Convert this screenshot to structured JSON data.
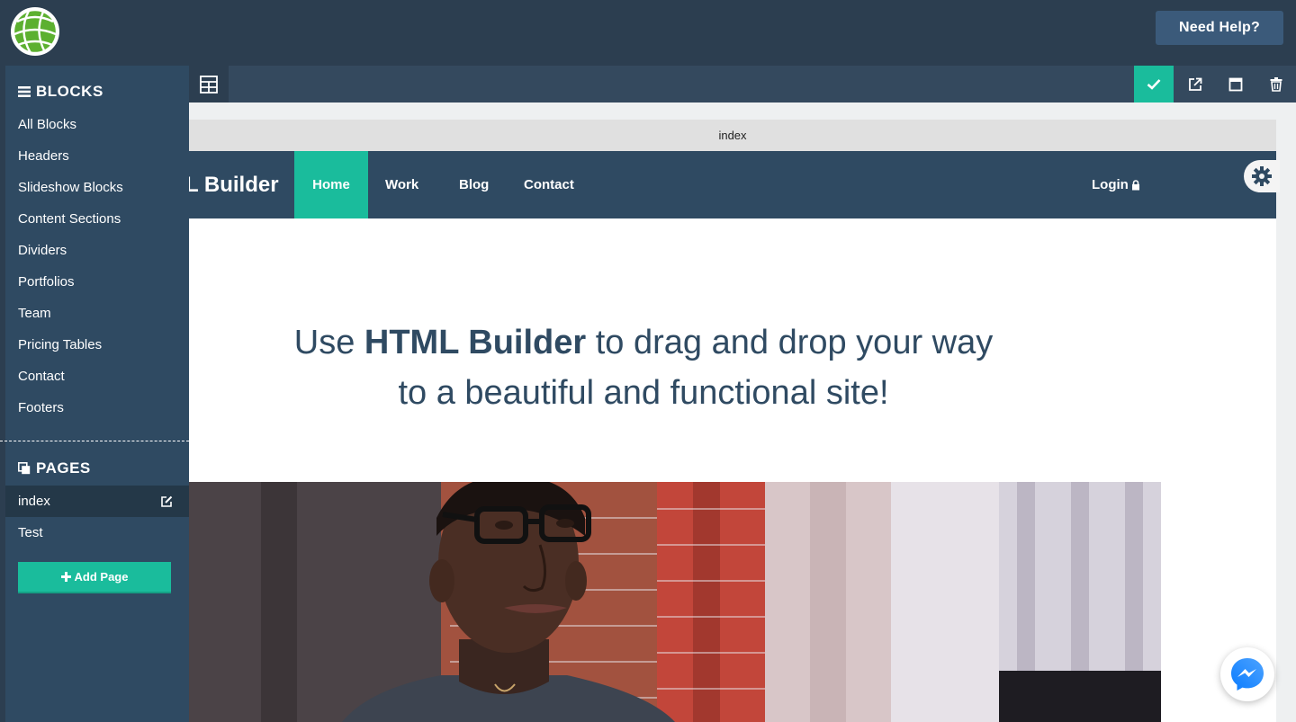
{
  "topbar": {
    "help_label": "Need Help?"
  },
  "sidebar": {
    "blocks_heading": "BLOCKS",
    "blocks": [
      "All Blocks",
      "Headers",
      "Slideshow Blocks",
      "Content Sections",
      "Dividers",
      "Portfolios",
      "Team",
      "Pricing Tables",
      "Contact",
      "Footers"
    ],
    "pages_heading": "PAGES",
    "pages": [
      {
        "label": "index",
        "active": true
      },
      {
        "label": "Test",
        "active": false
      }
    ],
    "add_page_label": "Add Page"
  },
  "canvas": {
    "tab_label": "index",
    "site": {
      "brand": "L Builder",
      "nav": {
        "home": "Home",
        "work": "Work",
        "blog": "Blog",
        "contact": "Contact",
        "login": "Login"
      },
      "hero": {
        "line1_pre": "Use ",
        "line1_bold": "HTML Builder",
        "line1_post": " to drag and drop your way",
        "line2": "to a beautiful and functional site!"
      }
    }
  },
  "icons": {
    "logo": "globe-icon",
    "grid": "grid-icon",
    "check": "check-icon",
    "external": "external-link-icon",
    "window": "window-icon",
    "trash": "trash-icon",
    "gear": "gear-icon",
    "messenger": "messenger-icon"
  },
  "colors": {
    "accent": "#1abc9c",
    "navy": "#2f4a62",
    "topbar": "#2c3e50"
  }
}
